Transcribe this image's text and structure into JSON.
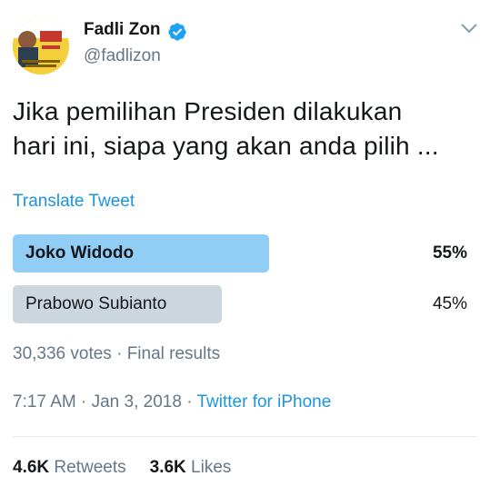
{
  "author": {
    "name": "Fadli Zon",
    "handle": "@fadlizon",
    "verified": true
  },
  "tweet": {
    "text_line1": "Jika pemilihan Presiden dilakukan",
    "text_line2": "hari ini, siapa yang akan anda pilih ...",
    "translate_label": "Translate Tweet"
  },
  "poll": {
    "options": [
      {
        "label": "Joko Widodo",
        "percent_text": "55%",
        "percent": 55,
        "winner": true,
        "bar_color": "#91cdf5"
      },
      {
        "label": "Prabowo Subianto",
        "percent_text": "45%",
        "percent": 45,
        "winner": false,
        "bar_color": "#ccd6dd"
      }
    ],
    "votes": "30,336 votes",
    "status": "Final results"
  },
  "meta": {
    "time": "7:17 AM",
    "date": "Jan 3, 2018",
    "source": "Twitter for iPhone"
  },
  "stats": {
    "retweets_count": "4.6K",
    "retweets_label": "Retweets",
    "likes_count": "3.6K",
    "likes_label": "Likes"
  },
  "colors": {
    "link": "#1b95e0",
    "muted": "#657786",
    "verified": "#1da1f2"
  },
  "icons": {
    "verified": "verified-badge-icon",
    "menu": "chevron-down-icon"
  }
}
